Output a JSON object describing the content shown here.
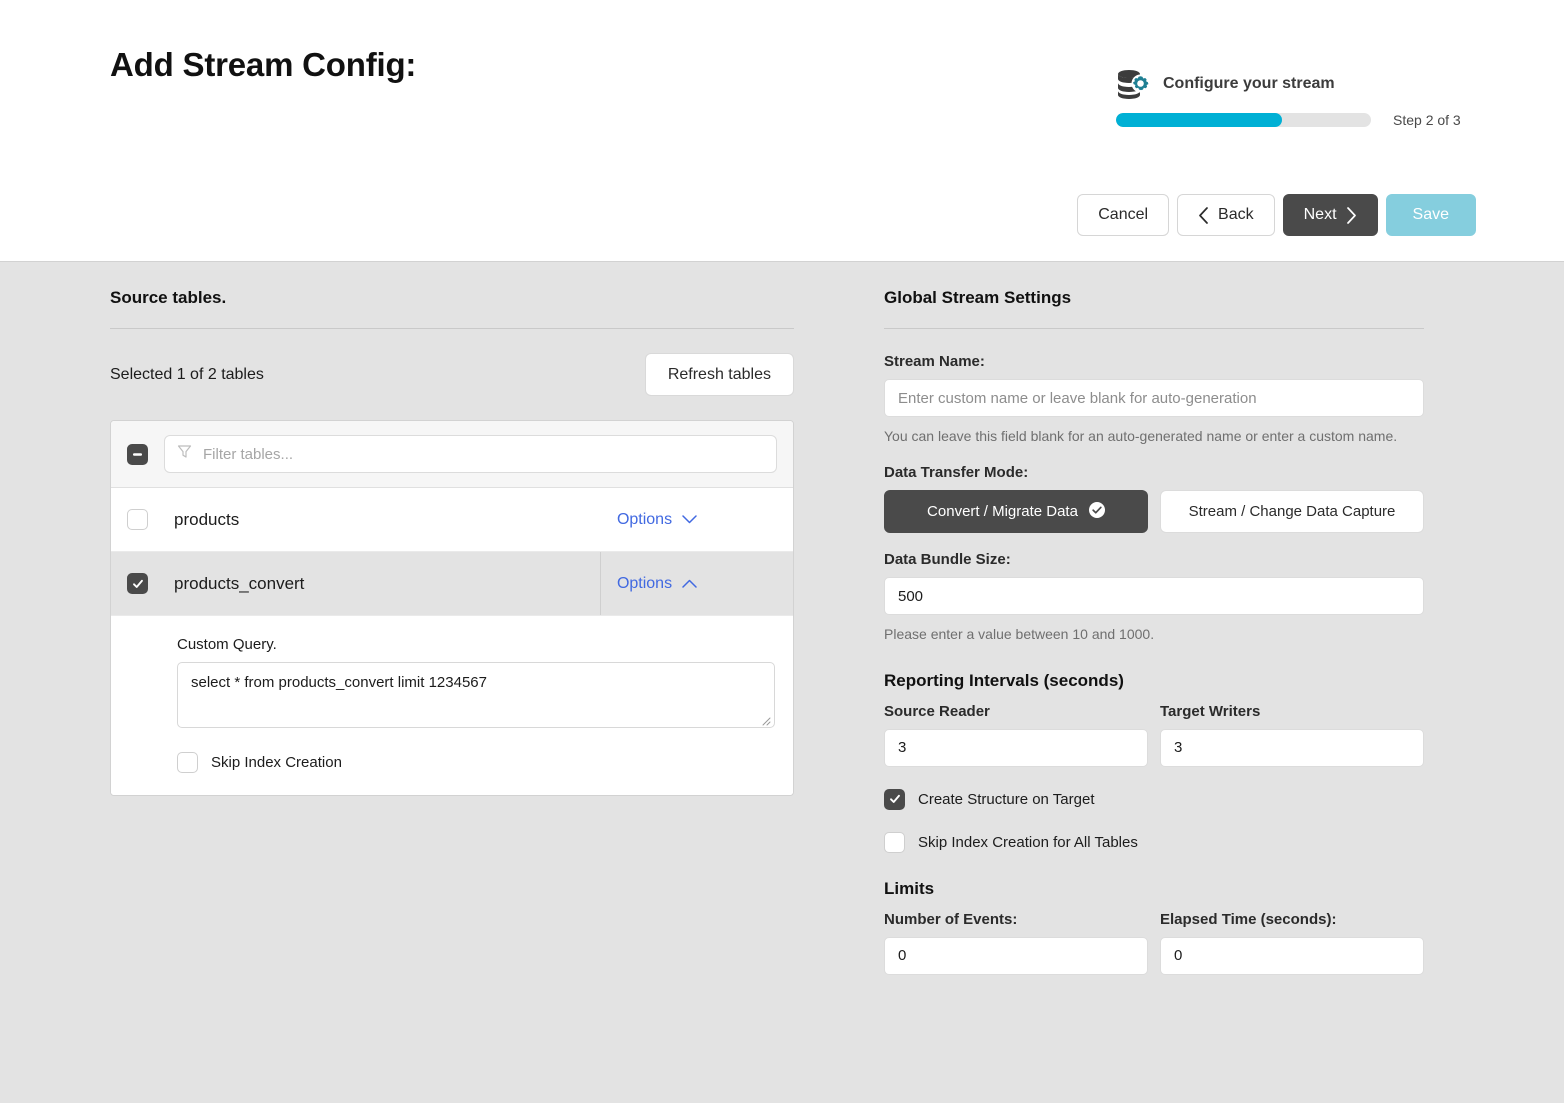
{
  "header": {
    "title": "Add Stream Config:",
    "wizard_label": "Configure your stream",
    "wizard_icon": "database-gear-icon",
    "step_text": "Step 2 of 3",
    "progress_percent": 65,
    "progress_color": "#00b0d5",
    "buttons": {
      "cancel": "Cancel",
      "back": "Back",
      "next": "Next",
      "save": "Save"
    }
  },
  "source_tables": {
    "section_title": "Source tables.",
    "selected_summary": "Selected 1 of 2 tables",
    "refresh_label": "Refresh tables",
    "filter_placeholder": "Filter tables...",
    "filter_value": "",
    "header_checkbox_state": "indeterminate",
    "rows": [
      {
        "name": "products",
        "checked": false,
        "options_label": "Options",
        "expanded": false
      },
      {
        "name": "products_convert",
        "checked": true,
        "options_label": "Options",
        "expanded": true
      }
    ],
    "expanded_panel": {
      "custom_query_label": "Custom Query.",
      "custom_query_value": "select * from products_convert limit 1234567",
      "skip_index_label": "Skip Index Creation",
      "skip_index_checked": false
    }
  },
  "global_settings": {
    "section_title": "Global Stream Settings",
    "stream_name_label": "Stream Name:",
    "stream_name_value": "",
    "stream_name_placeholder": "Enter custom name or leave blank for auto-generation",
    "stream_name_helper": "You can leave this field blank for an auto-generated name or enter a custom name.",
    "transfer_mode_label": "Data Transfer Mode:",
    "transfer_mode_options": [
      {
        "label": "Convert / Migrate Data",
        "selected": true
      },
      {
        "label": "Stream / Change Data Capture",
        "selected": false
      }
    ],
    "bundle_size_label": "Data Bundle Size:",
    "bundle_size_value": "500",
    "bundle_size_helper": "Please enter a value between 10 and 1000.",
    "reporting_title": "Reporting Intervals (seconds)",
    "source_reader_label": "Source Reader",
    "source_reader_value": "3",
    "target_writers_label": "Target Writers",
    "target_writers_value": "3",
    "create_structure_label": "Create Structure on Target",
    "create_structure_checked": true,
    "skip_index_all_label": "Skip Index Creation for All Tables",
    "skip_index_all_checked": false,
    "limits_title": "Limits",
    "number_of_events_label": "Number of Events:",
    "number_of_events_value": "0",
    "elapsed_time_label": "Elapsed Time (seconds):",
    "elapsed_time_value": "0"
  }
}
